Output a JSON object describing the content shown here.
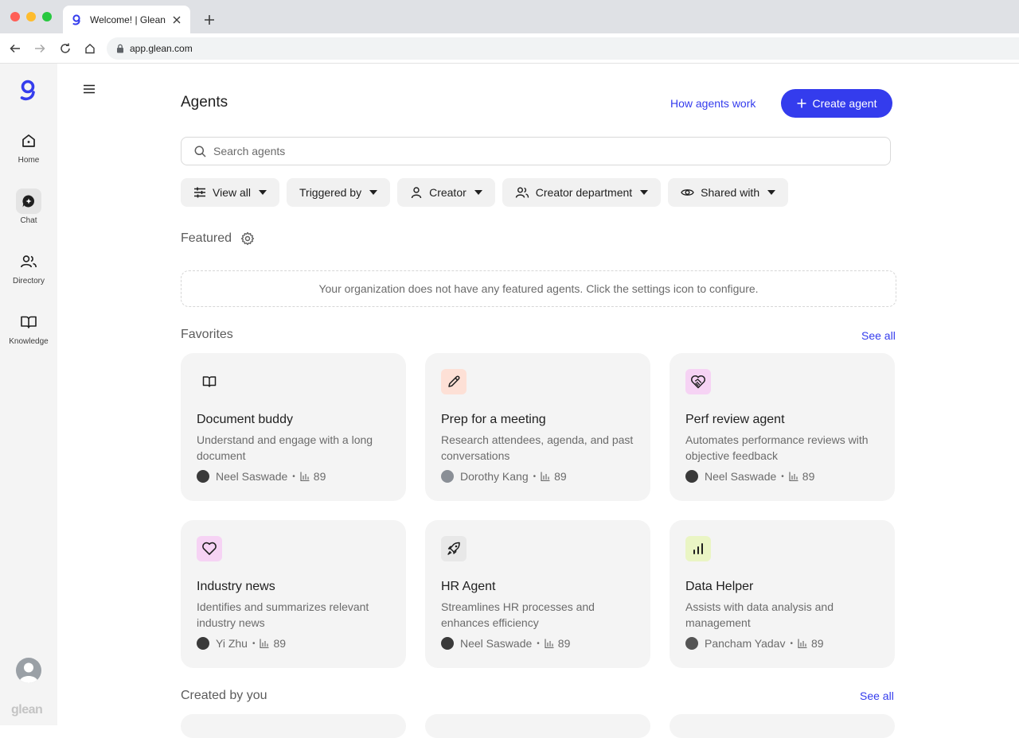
{
  "browser": {
    "tab_title": "Welcome! | Glean",
    "url": "app.glean.com"
  },
  "rail": {
    "items": [
      {
        "label": "Home",
        "icon": "home-icon"
      },
      {
        "label": "Chat",
        "icon": "chat-icon",
        "active": true
      },
      {
        "label": "Directory",
        "icon": "people-icon"
      },
      {
        "label": "Knowledge",
        "icon": "book-icon"
      }
    ],
    "wordmark": "glean"
  },
  "header": {
    "title": "Agents",
    "how_link": "How agents work",
    "create_label": "Create agent"
  },
  "search": {
    "placeholder": "Search agents"
  },
  "filters": [
    "View all",
    "Triggered by",
    "Creator",
    "Creator department",
    "Shared with"
  ],
  "featured": {
    "label": "Featured",
    "empty_text": "Your organization does not have any featured agents. Click the settings icon to configure."
  },
  "favorites": {
    "label": "Favorites",
    "see_all": "See all",
    "cards": [
      {
        "title": "Document buddy",
        "desc": "Understand and engage with a long document",
        "author": "Neel Saswade",
        "uses": "89",
        "icon": "book-icon",
        "icon_bg": "#f4f4f4"
      },
      {
        "title": "Prep for a meeting",
        "desc": "Research attendees, agenda, and past conversations",
        "author": "Dorothy Kang",
        "uses": "89",
        "icon": "pencil-icon",
        "icon_bg": "#fde0d6"
      },
      {
        "title": "Perf review agent",
        "desc": "Automates performance reviews with objective feedback",
        "author": "Neel Saswade",
        "uses": "89",
        "icon": "handshake-heart-icon",
        "icon_bg": "#f6d3f4"
      },
      {
        "title": "Industry news",
        "desc": "Identifies and summarizes relevant industry news",
        "author": "Yi Zhu",
        "uses": "89",
        "icon": "heart-icon",
        "icon_bg": "#f6d3f4"
      },
      {
        "title": "HR Agent",
        "desc": "Streamlines HR processes and enhances efficiency",
        "author": "Neel Saswade",
        "uses": "89",
        "icon": "rocket-icon",
        "icon_bg": "#e8e8e8"
      },
      {
        "title": "Data Helper",
        "desc": "Assists with data analysis and management",
        "author": "Pancham Yadav",
        "uses": "89",
        "icon": "bar-chart-icon",
        "icon_bg": "#eaf5c4"
      }
    ]
  },
  "created": {
    "label": "Created by you",
    "see_all": "See all"
  },
  "colors": {
    "accent": "#343ced",
    "rail_bg": "#f4f4f4",
    "card_bg": "#f4f4f4"
  }
}
